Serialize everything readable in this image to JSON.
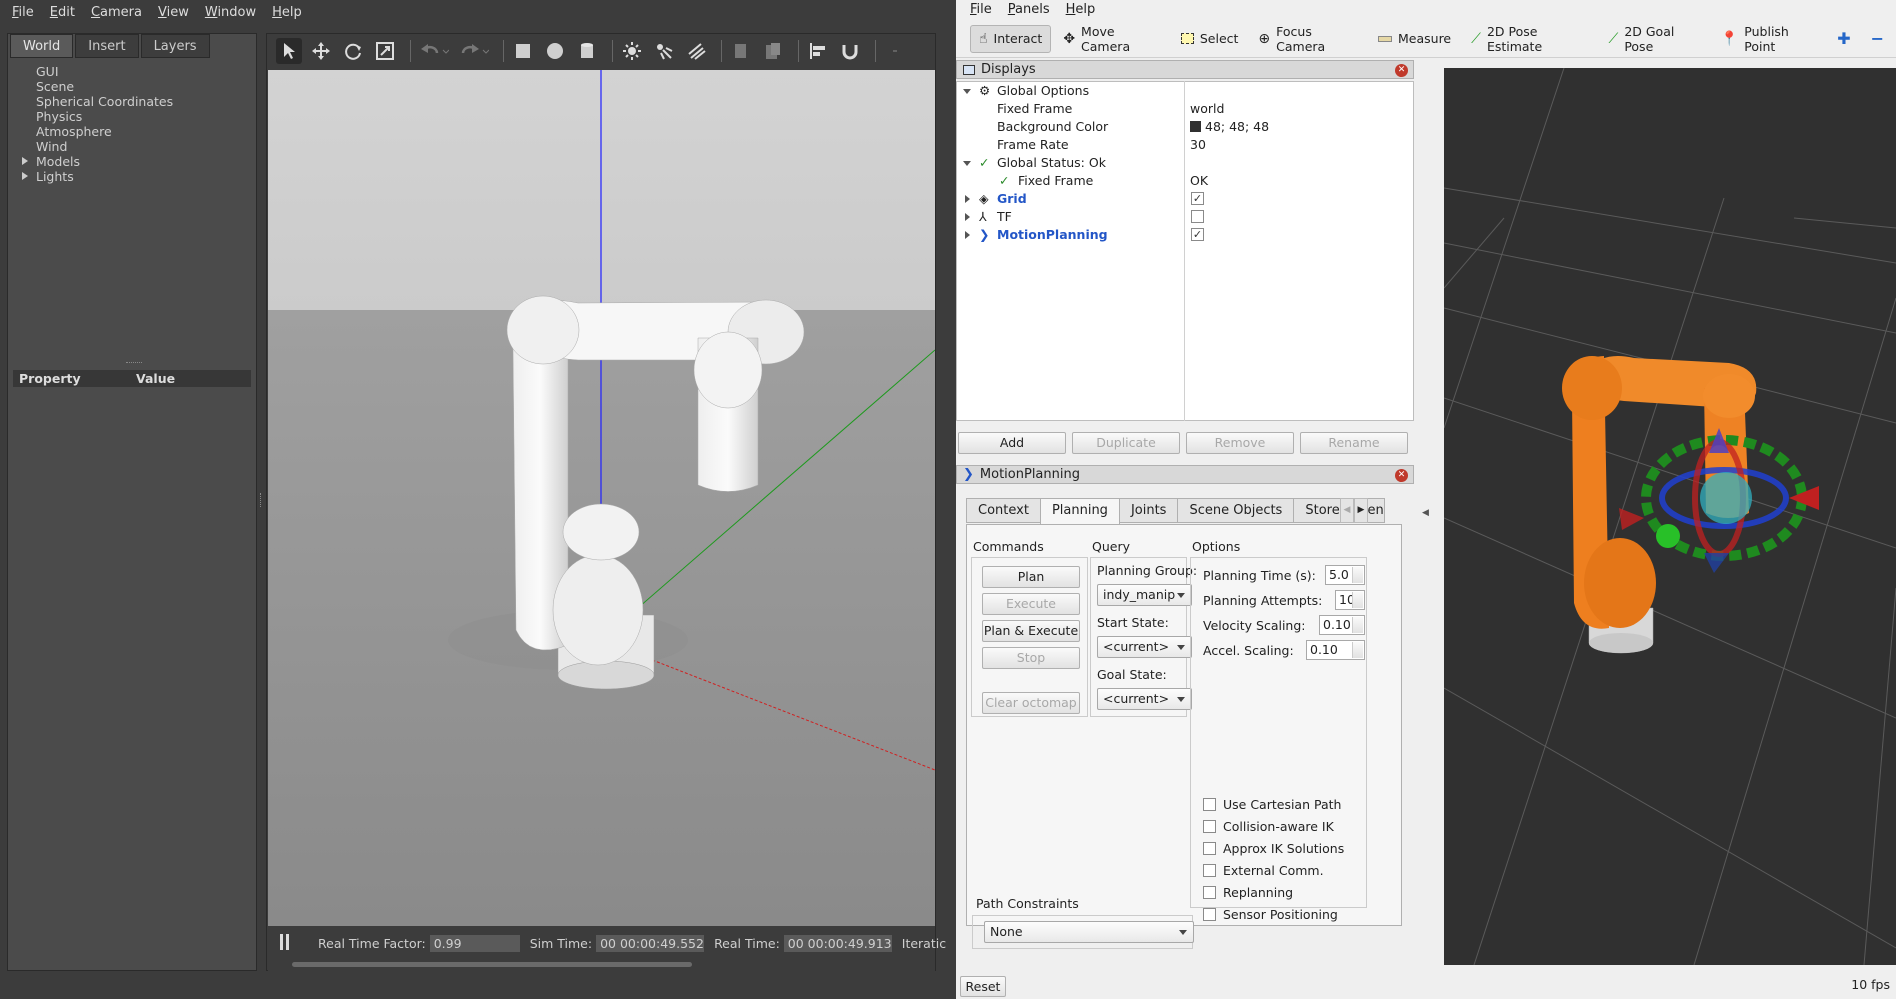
{
  "gazebo": {
    "menu": [
      "File",
      "Edit",
      "Camera",
      "View",
      "Window",
      "Help"
    ],
    "left_tabs": [
      "World",
      "Insert",
      "Layers"
    ],
    "tree": [
      "GUI",
      "Scene",
      "Spherical Coordinates",
      "Physics",
      "Atmosphere",
      "Wind",
      "Models",
      "Lights"
    ],
    "prop_header": {
      "property": "Property",
      "value": "Value"
    },
    "status": {
      "rtf_label": "Real Time Factor:",
      "rtf": "0.99",
      "sim_label": "Sim Time:",
      "sim": "00 00:00:49.552",
      "real_label": "Real Time:",
      "real": "00 00:00:49.913",
      "iter_label": "Iteratic"
    }
  },
  "rviz": {
    "menu": [
      "File",
      "Panels",
      "Help"
    ],
    "tools": [
      {
        "label": "Interact",
        "icon": "interact-icon"
      },
      {
        "label": "Move Camera",
        "icon": "move-camera-icon"
      },
      {
        "label": "Select",
        "icon": "select-icon"
      },
      {
        "label": "Focus Camera",
        "icon": "focus-camera-icon"
      },
      {
        "label": "Measure",
        "icon": "measure-icon"
      },
      {
        "label": "2D Pose Estimate",
        "icon": "pose-estimate-icon"
      },
      {
        "label": "2D Goal Pose",
        "icon": "goal-pose-icon"
      },
      {
        "label": "Publish Point",
        "icon": "publish-point-icon"
      }
    ],
    "displays": {
      "title": "Displays",
      "global_options": "Global Options",
      "fixed_frame_label": "Fixed Frame",
      "fixed_frame": "world",
      "bg_label": "Background Color",
      "bg": "48; 48; 48",
      "fr_label": "Frame Rate",
      "fr": "30",
      "status_label": "Global Status: Ok",
      "status_ff_label": "Fixed Frame",
      "status_ff": "OK",
      "grid": "Grid",
      "tf": "TF",
      "mp": "MotionPlanning",
      "buttons": {
        "add": "Add",
        "duplicate": "Duplicate",
        "remove": "Remove",
        "rename": "Rename"
      }
    },
    "motion": {
      "title": "MotionPlanning",
      "tabs": [
        "Context",
        "Planning",
        "Joints",
        "Scene Objects",
        "Stored Scenes"
      ],
      "commands_label": "Commands",
      "plan": "Plan",
      "execute": "Execute",
      "plan_execute": "Plan & Execute",
      "stop": "Stop",
      "clear_octomap": "Clear octomap",
      "query_label": "Query",
      "planning_group_label": "Planning Group:",
      "planning_group": "indy_manip",
      "start_state_label": "Start State:",
      "start_state": "<current>",
      "goal_state_label": "Goal State:",
      "goal_state": "<current>",
      "options_label": "Options",
      "ptime_label": "Planning Time (s):",
      "ptime": "5.0",
      "pattempts_label": "Planning Attempts:",
      "pattempts": "10",
      "vscale_label": "Velocity Scaling:",
      "vscale": "0.10",
      "ascale_label": "Accel. Scaling:",
      "ascale": "0.10",
      "checkboxes": [
        "Use Cartesian Path",
        "Collision-aware IK",
        "Approx IK Solutions",
        "External Comm.",
        "Replanning",
        "Sensor Positioning"
      ],
      "path_constraints_label": "Path Constraints",
      "path_constraints": "None"
    },
    "reset": "Reset",
    "fps": "10 fps",
    "colors": {
      "viewport_bg": "#303030",
      "robot": "#ee7f1f"
    }
  }
}
